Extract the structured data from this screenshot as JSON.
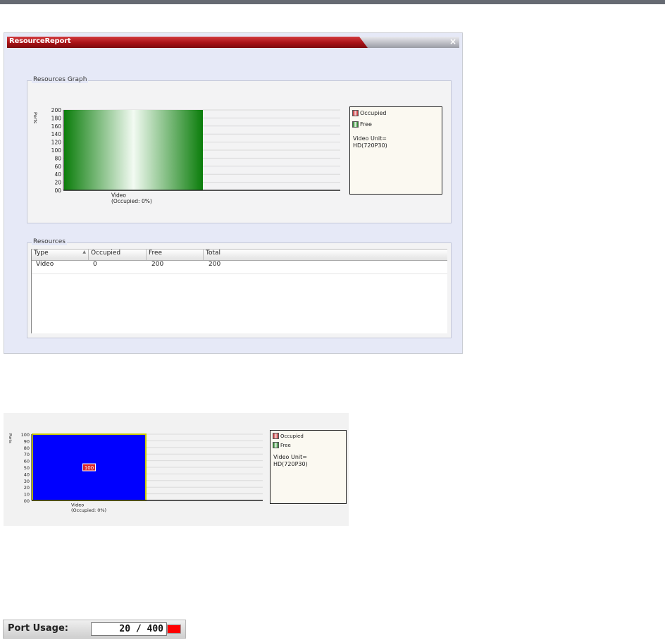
{
  "window": {
    "title": "ResourceReport",
    "close_label": "×"
  },
  "graph_group": {
    "label": "Resources Graph"
  },
  "resources_group": {
    "label": "Resources",
    "columns": [
      "Type",
      "Occupied",
      "Free",
      "Total"
    ],
    "rows": [
      {
        "type": "Video",
        "occupied": "0",
        "free": "200",
        "total": "200"
      }
    ]
  },
  "chart_data": [
    {
      "type": "bar",
      "ylabel": "Ports",
      "categories": [
        "Video"
      ],
      "category_sub": [
        "(Occupied: 0%)"
      ],
      "yticks": [
        "200",
        "180",
        "160",
        "140",
        "120",
        "100",
        "80",
        "60",
        "40",
        "20",
        "00"
      ],
      "ylim": [
        0,
        200
      ],
      "series": [
        {
          "name": "Free",
          "values": [
            200
          ]
        }
      ],
      "legend": [
        "Occupied",
        "Free"
      ],
      "legend_note": [
        "Video Unit=",
        "HD(720P30)"
      ],
      "colors": {
        "bar": "#1f8a1f",
        "occupied": "#c0282c",
        "free": "#1a7d1a"
      }
    },
    {
      "type": "bar",
      "ylabel": "Ports",
      "categories": [
        "Video"
      ],
      "category_sub": [
        "(Occupied: 0%)"
      ],
      "yticks": [
        "100",
        "90",
        "80",
        "70",
        "60",
        "50",
        "40",
        "30",
        "20",
        "10",
        "00"
      ],
      "ylim": [
        0,
        100
      ],
      "series": [
        {
          "name": "",
          "values": [
            100
          ]
        }
      ],
      "data_labels": [
        "100"
      ],
      "legend": [
        "Occupied",
        "Free"
      ],
      "legend_note": [
        "Video Unit=",
        "HD(720P30)"
      ],
      "colors": {
        "bar": "#0000ff",
        "bar_border": "#c9c900"
      }
    }
  ],
  "port_usage": {
    "label": "Port Usage:",
    "value": "20 / 400",
    "indicator_color": "#ff0000"
  }
}
